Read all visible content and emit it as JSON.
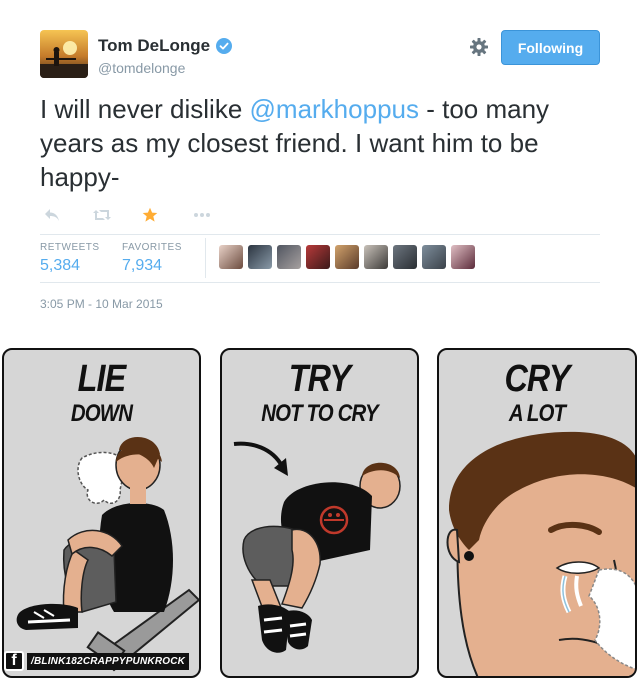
{
  "tweet": {
    "author_name": "Tom DeLonge",
    "author_handle": "@tomdelonge",
    "follow_label": "Following",
    "text_before": "I will never dislike ",
    "mention": "@markhoppus",
    "text_after": " - too many years as my closest friend. I want him to be happy-",
    "retweets_label": "RETWEETS",
    "retweets_count": "5,384",
    "favorites_label": "FAVORITES",
    "favorites_count": "7,934",
    "timestamp": "3:05 PM - 10 Mar 2015",
    "favorited": true,
    "colors": {
      "link": "#55acee",
      "star": "#ffac33",
      "muted": "#8899a6",
      "button": "#55acee"
    },
    "icons": [
      "verified-badge-icon",
      "gear-icon",
      "reply-icon",
      "retweet-icon",
      "favorite-star-icon",
      "more-icon"
    ]
  },
  "meme": {
    "panels": [
      {
        "big": "LIE",
        "small": "DOWN"
      },
      {
        "big": "TRY",
        "small": "NOT TO CRY"
      },
      {
        "big": "CRY",
        "small": "A LOT"
      }
    ],
    "watermark_letter": "f",
    "watermark_text": "/BLINK182CRAPPYPUNKROCK"
  }
}
